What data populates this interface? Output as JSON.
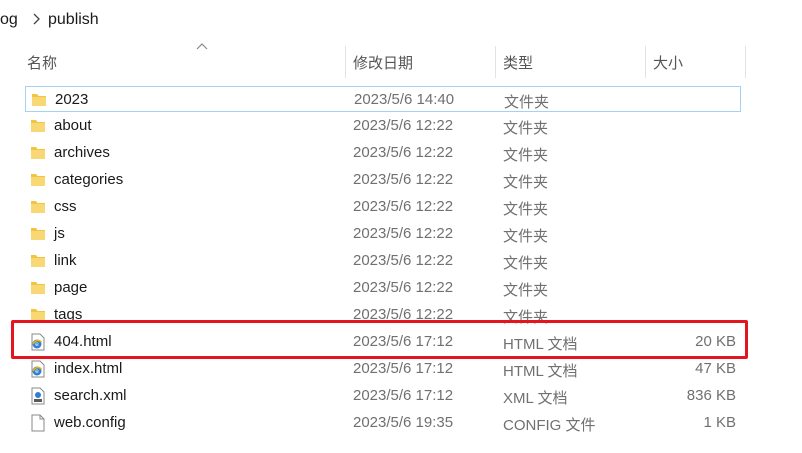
{
  "breadcrumb": {
    "items": [
      "og",
      "publish"
    ]
  },
  "columns": {
    "name": "名称",
    "date": "修改日期",
    "type": "类型",
    "size": "大小"
  },
  "files": [
    {
      "name": "2023",
      "date": "2023/5/6 14:40",
      "type": "文件夹",
      "size": "",
      "icon": "folder-icon"
    },
    {
      "name": "about",
      "date": "2023/5/6 12:22",
      "type": "文件夹",
      "size": "",
      "icon": "folder-icon"
    },
    {
      "name": "archives",
      "date": "2023/5/6 12:22",
      "type": "文件夹",
      "size": "",
      "icon": "folder-icon"
    },
    {
      "name": "categories",
      "date": "2023/5/6 12:22",
      "type": "文件夹",
      "size": "",
      "icon": "folder-icon"
    },
    {
      "name": "css",
      "date": "2023/5/6 12:22",
      "type": "文件夹",
      "size": "",
      "icon": "folder-icon"
    },
    {
      "name": "js",
      "date": "2023/5/6 12:22",
      "type": "文件夹",
      "size": "",
      "icon": "folder-icon"
    },
    {
      "name": "link",
      "date": "2023/5/6 12:22",
      "type": "文件夹",
      "size": "",
      "icon": "folder-icon"
    },
    {
      "name": "page",
      "date": "2023/5/6 12:22",
      "type": "文件夹",
      "size": "",
      "icon": "folder-icon"
    },
    {
      "name": "tags",
      "date": "2023/5/6 12:22",
      "type": "文件夹",
      "size": "",
      "icon": "folder-icon"
    },
    {
      "name": "404.html",
      "date": "2023/5/6 17:12",
      "type": "HTML 文档",
      "size": "20 KB",
      "icon": "html-file-icon"
    },
    {
      "name": "index.html",
      "date": "2023/5/6 17:12",
      "type": "HTML 文档",
      "size": "47 KB",
      "icon": "html-file-icon"
    },
    {
      "name": "search.xml",
      "date": "2023/5/6 17:12",
      "type": "XML 文档",
      "size": "836 KB",
      "icon": "xml-file-icon"
    },
    {
      "name": "web.config",
      "date": "2023/5/6 19:35",
      "type": "CONFIG 文件",
      "size": "1 KB",
      "icon": "config-file-icon"
    }
  ],
  "colors": {
    "highlight": "#e3161f",
    "selection_border": "#a6d2ef",
    "folder": "#f8d775"
  }
}
